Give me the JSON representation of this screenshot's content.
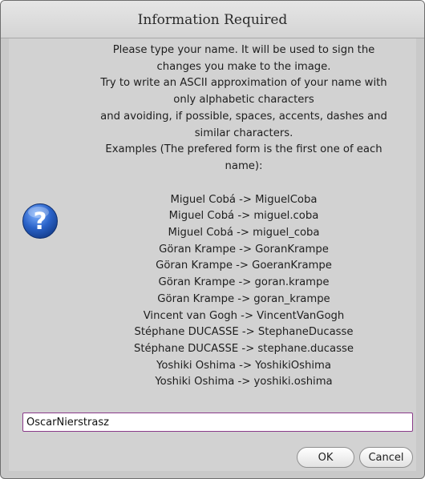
{
  "dialog": {
    "title": "Information Required",
    "icon": "question-mark-icon"
  },
  "message": {
    "lines": [
      "Please type your name. It will be used to sign the",
      "changes you make to the image.",
      "Try to write an ASCII approximation of your name with",
      "only alphabetic characters",
      "and avoiding, if possible, spaces, accents, dashes and",
      "similar characters.",
      "Examples (The prefered form is the first one of each",
      "name):"
    ],
    "examples": [
      "Miguel Cobá -> MiguelCoba",
      "Miguel Cobá -> miguel.coba",
      "Miguel Cobá -> miguel_coba",
      "Göran Krampe -> GoranKrampe",
      "Göran Krampe -> GoeranKrampe",
      "Göran Krampe -> goran.krampe",
      "Göran Krampe -> goran_krampe",
      "Vincent van Gogh -> VincentVanGogh",
      "Stéphane DUCASSE -> StephaneDucasse",
      "Stéphane DUCASSE -> stephane.ducasse",
      "Yoshiki Oshima -> YoshikiOshima",
      "Yoshiki Oshima -> yoshiki.oshima"
    ]
  },
  "name_field": {
    "value": "OscarNierstrasz"
  },
  "buttons": {
    "ok": "OK",
    "cancel": "Cancel"
  },
  "colors": {
    "dialog_bg": "#c9c9c9",
    "content_bg": "#d2d2d2",
    "input_border": "#8a3a8a",
    "icon_blue": "#2a62c8"
  }
}
